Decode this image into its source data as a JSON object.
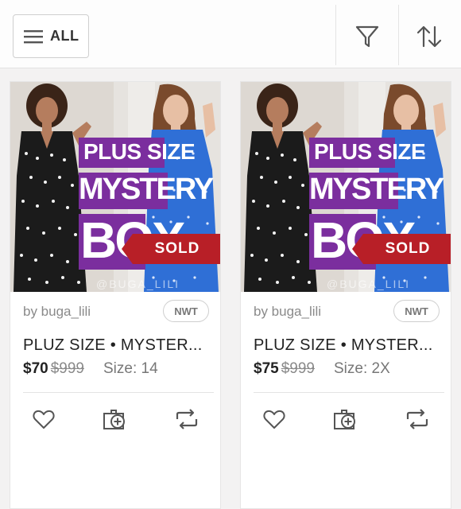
{
  "toolbar": {
    "all_label": "ALL",
    "icons": [
      "menu-icon",
      "filter-icon",
      "sort-icon"
    ]
  },
  "listings": [
    {
      "image_text": {
        "line1": "PLUS SIZE",
        "line2": "MYSTERY",
        "line3": "BOX"
      },
      "sold_label": "SOLD",
      "watermark": "@BUGA_LILI",
      "seller": "by buga_lili",
      "condition": "NWT",
      "title": "PLUZ SIZE • MYSTER...",
      "price": "$70",
      "original_price": "$999",
      "size": "Size: 14"
    },
    {
      "image_text": {
        "line1": "PLUS SIZE",
        "line2": "MYSTERY",
        "line3": "BOX"
      },
      "sold_label": "SOLD",
      "watermark": "@BUGA_LILI",
      "seller": "by buga_lili",
      "condition": "NWT",
      "title": "PLUZ SIZE • MYSTER...",
      "price": "$75",
      "original_price": "$999",
      "size": "Size: 2X"
    }
  ],
  "card_actions": [
    "heart-icon",
    "add-to-bundle-icon",
    "share-icon"
  ],
  "colors": {
    "accent_purple": "#7b2e9e",
    "sold_red": "#b81f27",
    "dress_blue": "#2f6fd6"
  }
}
